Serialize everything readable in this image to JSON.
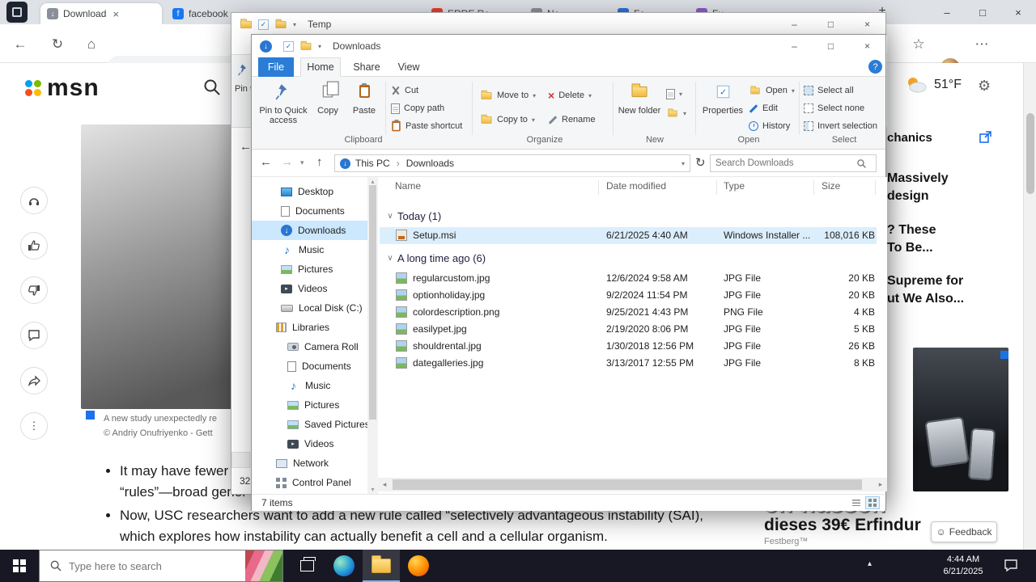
{
  "glyphs": {
    "minimize": "–",
    "maximize": "□",
    "close": "×",
    "back": "←",
    "forward": "→",
    "up": "↑",
    "refresh": "↻",
    "dropdown": "▾",
    "breadcrumb_sep": "›",
    "group_chevron": "∨",
    "down_arrow": "↓",
    "scroll_left": "◂",
    "scroll_right": "▸",
    "scroll_up": "▴",
    "scroll_down": "▾",
    "more_vertical": "⋮",
    "more_horizontal": "⋯",
    "star": "☆",
    "home": "⌂",
    "smiley": "☺",
    "gear": "⚙",
    "help": "?",
    "music_note": "♪",
    "check": "✓",
    "play": "▸",
    "tray_up": "▴"
  },
  "browser": {
    "tabs": [
      {
        "label": "Download"
      },
      {
        "label": "facebook"
      },
      {
        "label": "ERRE Re"
      },
      {
        "label": "No"
      },
      {
        "label": "Fo"
      },
      {
        "label": "Fu"
      }
    ],
    "new_tab_label": "+",
    "url": "https://www.msn.com"
  },
  "msn": {
    "logo": "msn",
    "weather_temp": "51°F",
    "caption_line1": "A new study unexpectedly re",
    "caption_line2": "© Andriy Onufriyenko - Gett",
    "bullet1_line1": "It may have fewer",
    "bullet1_line2": "“rules”—broad gener",
    "bullet2": "Now, USC researchers want to add a new rule called “selectively advantageous instability (SAI), which explores how instability can actually benefit a cell and a cellular organism.",
    "rail_header": "chanics",
    "rail_items": [
      {
        "line1": "Massively",
        "line2": "design"
      },
      {
        "line1": "? These",
        "line2": "To Be..."
      },
      {
        "line1": "Supreme for",
        "line2": "ut We Also..."
      }
    ],
    "ad_line1": "en hassen",
    "ad_line2": "dieses 39€ Erfindur",
    "ad_brand": "Festberg™",
    "feedback_label": "Feedback"
  },
  "temp_window": {
    "title": "Temp",
    "status_fragment": "32"
  },
  "explorer": {
    "title": "Downloads",
    "tabs": {
      "file": "File",
      "home": "Home",
      "share": "Share",
      "view": "View"
    },
    "ribbon": {
      "pin": "Pin to Quick access",
      "copy": "Copy",
      "paste": "Paste",
      "cut": "Cut",
      "copy_path": "Copy path",
      "paste_shortcut": "Paste shortcut",
      "move_to": "Move to",
      "copy_to": "Copy to",
      "delete": "Delete",
      "rename": "Rename",
      "new_folder": "New folder",
      "properties": "Properties",
      "open": "Open",
      "edit": "Edit",
      "history": "History",
      "select_all": "Select all",
      "select_none": "Select none",
      "invert_selection": "Invert selection",
      "groups": [
        "Clipboard",
        "Organize",
        "New",
        "Open",
        "Select"
      ]
    },
    "breadcrumb": {
      "root": "This PC",
      "current": "Downloads"
    },
    "search_placeholder": "Search Downloads",
    "columns": [
      "Name",
      "Date modified",
      "Type",
      "Size"
    ],
    "group1": {
      "label": "Today (1)"
    },
    "group2": {
      "label": "A long time ago (6)"
    },
    "files": [
      {
        "name": "Setup.msi",
        "modified": "6/21/2025 4:40 AM",
        "type": "Windows Installer ...",
        "size": "108,016 KB"
      },
      {
        "name": "regularcustom.jpg",
        "modified": "12/6/2024 9:58 AM",
        "type": "JPG File",
        "size": "20 KB"
      },
      {
        "name": "optionholiday.jpg",
        "modified": "9/2/2024 11:54 PM",
        "type": "JPG File",
        "size": "20 KB"
      },
      {
        "name": "colordescription.png",
        "modified": "9/25/2021 4:43 PM",
        "type": "PNG File",
        "size": "4 KB"
      },
      {
        "name": "easilypet.jpg",
        "modified": "2/19/2020 8:06 PM",
        "type": "JPG File",
        "size": "5 KB"
      },
      {
        "name": "shouldrental.jpg",
        "modified": "1/30/2018 12:56 PM",
        "type": "JPG File",
        "size": "26 KB"
      },
      {
        "name": "dategalleries.jpg",
        "modified": "3/13/2017 12:55 PM",
        "type": "JPG File",
        "size": "8 KB"
      }
    ],
    "nav": [
      {
        "label": "Desktop"
      },
      {
        "label": "Documents"
      },
      {
        "label": "Downloads"
      },
      {
        "label": "Music"
      },
      {
        "label": "Pictures"
      },
      {
        "label": "Videos"
      },
      {
        "label": "Local Disk (C:)"
      },
      {
        "label": "Libraries"
      },
      {
        "label": "Camera Roll"
      },
      {
        "label": "Documents"
      },
      {
        "label": "Music"
      },
      {
        "label": "Pictures"
      },
      {
        "label": "Saved Pictures"
      },
      {
        "label": "Videos"
      },
      {
        "label": "Network"
      },
      {
        "label": "Control Panel"
      }
    ],
    "status": "7 items"
  },
  "taskbar": {
    "search_placeholder": "Type here to search",
    "time": "4:44 AM",
    "date": "6/21/2025"
  }
}
